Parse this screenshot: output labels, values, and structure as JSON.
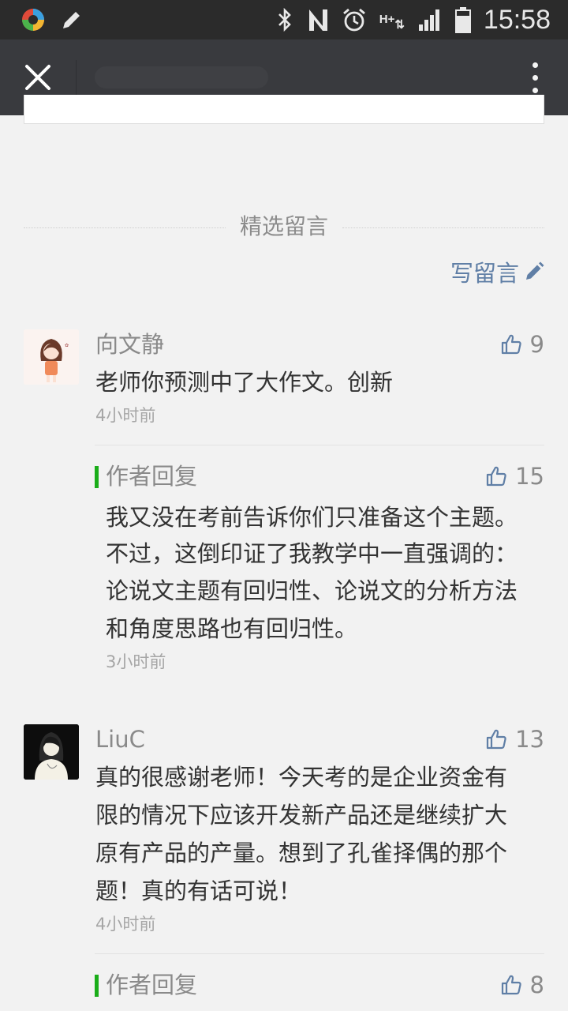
{
  "status_bar": {
    "time": "15:58",
    "icons": [
      "app-logo-icon",
      "pencil-icon",
      "bluetooth-icon",
      "nfc-icon",
      "alarm-icon",
      "hplus-icon",
      "signal-icon",
      "battery-icon"
    ],
    "hplus": "H+"
  },
  "app_bar": {
    "close_icon": "close-icon",
    "more_icon": "more-vertical-icon"
  },
  "section": {
    "title": "精选留言",
    "write_label": "写留言"
  },
  "comments": [
    {
      "name": "向文静",
      "likes": "9",
      "text": "老师你预测中了大作文。创新",
      "time": "4小时前",
      "reply": {
        "label": "作者回复",
        "likes": "15",
        "lines": [
          "我又没在考前告诉你们只准备这个主题。",
          "不过，这倒印证了我教学中一直强调的：",
          "论说文主题有回归性、论说文的分析方法",
          "和角度思路也有回归性。"
        ],
        "time": "3小时前"
      }
    },
    {
      "name": "LiuC",
      "likes": "13",
      "lines": [
        "真的很感谢老师！今天考的是企业资金有",
        "限的情况下应该开发新产品还是继续扩大",
        "原有产品的产量。想到了孔雀择偶的那个",
        "题！真的有话可说！"
      ],
      "time": "4小时前",
      "reply": {
        "label": "作者回复",
        "likes": "8"
      }
    }
  ],
  "colors": {
    "status_bar": "#2b2b2b",
    "app_bar": "#393a3e",
    "background": "#f2f2f2",
    "link": "#607fa6",
    "reply_accent": "#1aad19"
  }
}
